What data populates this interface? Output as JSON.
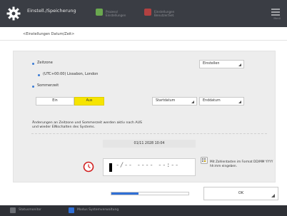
{
  "header": {
    "title": "Einstell./Speicherung",
    "items": [
      {
        "label": "Prozess/\nEinstellungen",
        "icon": "puzzle-icon",
        "color": "#6aa84f"
      },
      {
        "label": "Einstellungen\nBenutzer/Set.",
        "icon": "settings-tag-icon",
        "color": "#b24141"
      }
    ],
    "menu_label": "Menü"
  },
  "subheading": "<Einstellungen Datum/Zeit>",
  "timezone": {
    "label": "Zeitzone",
    "value": "(UTC+00:00) Lissabon, London",
    "button": "Einstellen"
  },
  "dst": {
    "label": "Sommerzeit",
    "on_label": "Ein",
    "off_label": "Aus",
    "start_button": "Startdatum",
    "end_button": "Enddatum"
  },
  "note": "Änderungen an Zeitzone und Sommerzeit werden aktiv nach AUS und wieder EINschalten des Systems.",
  "current_datetime": "01/11 2028 10:04",
  "input": {
    "mask": "▪/▪▪ ▪▪▪▪ ▪▪:▪▪",
    "display": "-/-- ---- --:--"
  },
  "hint": "Mit Zahlentasten im Format DD/MM YYYY hh:mm eingeben.",
  "ok_button": "OK",
  "progress": 0.35,
  "footer": {
    "status_label": "Statusmonitor",
    "mode_label": "Modus Systemverwaltung"
  },
  "colors": {
    "accent_yellow": "#f6e400",
    "accent_blue": "#2f6fd6",
    "alert_red": "#d21f1f"
  }
}
